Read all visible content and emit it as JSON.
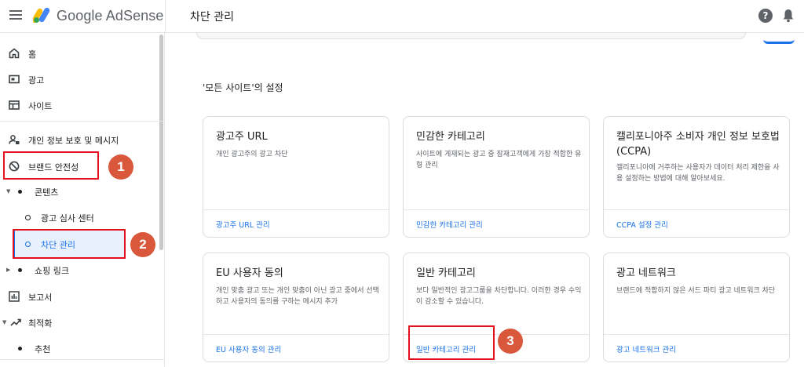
{
  "header": {
    "brand": "Google AdSense",
    "page_title": "차단 관리",
    "help_symbol": "?"
  },
  "sidebar": {
    "items": [
      {
        "label": "홈",
        "icon": "home-icon"
      },
      {
        "label": "광고",
        "icon": "ads-icon"
      },
      {
        "label": "사이트",
        "icon": "sites-icon"
      },
      {
        "label": "개인 정보 보호 및 메시지",
        "icon": "privacy-icon"
      },
      {
        "label": "브랜드 안전성",
        "icon": "block-icon"
      },
      {
        "label": "콘텐츠",
        "icon": "dot-icon"
      },
      {
        "label": "광고 심사 센터",
        "icon": "ring-icon"
      },
      {
        "label": "차단 관리",
        "icon": "ring-icon"
      },
      {
        "label": "쇼핑 링크",
        "icon": "dot-icon"
      },
      {
        "label": "보고서",
        "icon": "reports-icon"
      },
      {
        "label": "최적화",
        "icon": "trend-icon"
      },
      {
        "label": "추천",
        "icon": "dot-icon"
      }
    ]
  },
  "main": {
    "section_title": "'모든 사이트'의 설정",
    "cards": [
      {
        "title": "광고주 URL",
        "desc": "개인 광고주의 광고 차단",
        "link": "광고주 URL 관리"
      },
      {
        "title": "민감한 카테고리",
        "desc": "사이트에 게재되는 광고 중 잠재고객에게 가장 적합한 유형 관리",
        "link": "민감한 카테고리 관리"
      },
      {
        "title": "캘리포니아주 소비자 개인 정보 보호법(CCPA)",
        "desc": "캘리포니아에 거주하는 사용자가 데이터 처리 제한을 사용 설정하는 방법에 대해 알아보세요.",
        "link": "CCPA 설정 관리"
      },
      {
        "title": "EU 사용자 동의",
        "desc": "개인 맞춤 광고 또는 개인 맞춤이 아닌 광고 중에서 선택하고 사용자의 동의를 구하는 메시지 추가",
        "link": "EU 사용자 동의 관리"
      },
      {
        "title": "일반 카테고리",
        "desc": "보다 일반적인 광고그룹을 차단합니다. 이러한 경우 수익이 감소할 수 있습니다.",
        "link": "일반 카테고리 관리"
      },
      {
        "title": "광고 네트워크",
        "desc": "브랜드에 적합하지 않은 서드 파티 광고 네트워크 차단",
        "link": "광고 네트워크 관리"
      }
    ]
  },
  "annotations": {
    "badges": [
      "1",
      "2",
      "3"
    ],
    "color": "#e3101e",
    "badge_color": "#d9573b"
  },
  "colors": {
    "link": "#1a73e8",
    "active_bg": "#e8f0fe"
  }
}
